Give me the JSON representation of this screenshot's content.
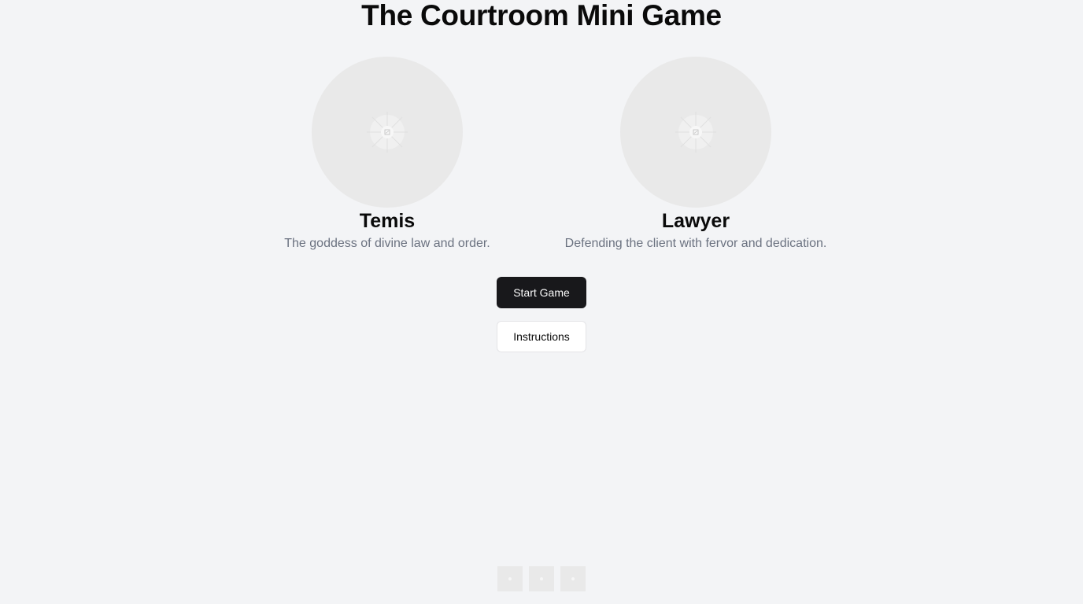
{
  "title": "The Courtroom Mini Game",
  "characters": [
    {
      "name": "Temis",
      "description": "The goddess of divine law and order.",
      "portrait_icon": "image-placeholder-icon"
    },
    {
      "name": "Lawyer",
      "description": "Defending the client with fervor and dedication.",
      "portrait_icon": "image-placeholder-icon"
    }
  ],
  "actions": {
    "start_label": "Start Game",
    "instructions_label": "Instructions"
  },
  "thumbnails": [
    {
      "icon": "image-placeholder-icon"
    },
    {
      "icon": "image-placeholder-icon"
    },
    {
      "icon": "image-placeholder-icon"
    }
  ],
  "colors": {
    "background": "#f3f4f6",
    "primary_button": "#18181b",
    "muted_text": "#6b7280",
    "placeholder": "#e9e9e9"
  }
}
